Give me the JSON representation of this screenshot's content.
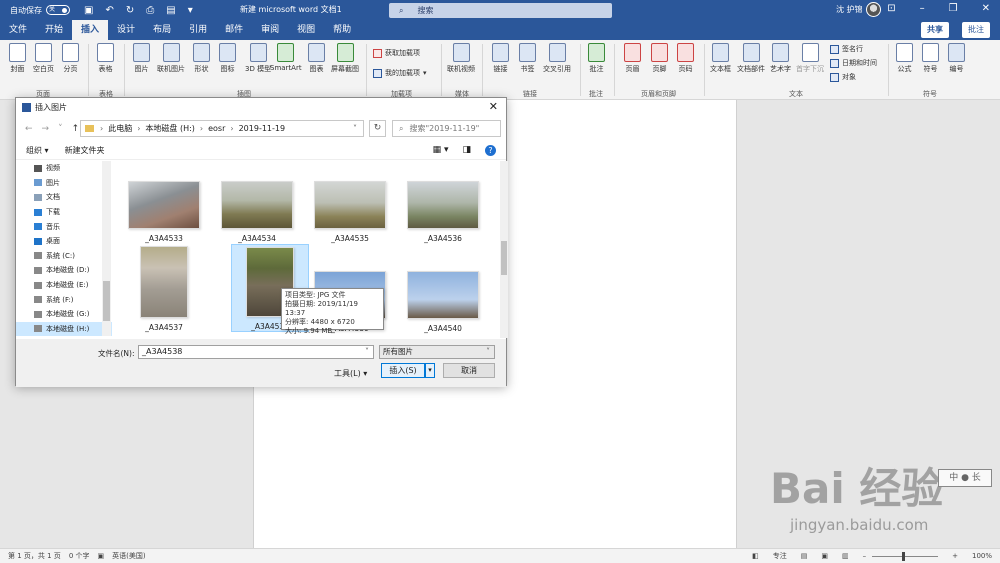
{
  "titlebar": {
    "autosave_label": "自动保存",
    "autosave_state": "关",
    "doc_title": "新建 microsoft word 文档1",
    "search_placeholder": "搜索",
    "user_name": "沈 护锦"
  },
  "tabs": [
    "文件",
    "开始",
    "插入",
    "设计",
    "布局",
    "引用",
    "邮件",
    "审阅",
    "视图",
    "帮助"
  ],
  "active_tab": "插入",
  "share_label": "共享",
  "comment_label": "批注",
  "ribbon": {
    "pages": [
      "封面",
      "空白页",
      "分页"
    ],
    "table": "表格",
    "illustrations": [
      "图片",
      "联机图片",
      "形状",
      "图标",
      "3D 模型",
      "SmartArt",
      "图表",
      "屏幕截图"
    ],
    "addins": [
      "获取加载项",
      "我的加载项"
    ],
    "media": "联机视频",
    "links": [
      "链接",
      "书签",
      "交叉引用"
    ],
    "comment": "批注",
    "header_footer": [
      "页眉",
      "页脚",
      "页码"
    ],
    "text": [
      "文本框",
      "文档部件",
      "艺术字",
      "首字下沉"
    ],
    "text_small": [
      "签名行",
      "日期和时间",
      "对象"
    ],
    "symbols": [
      "公式",
      "符号",
      "编号"
    ],
    "groups": [
      "页面",
      "表格",
      "插图",
      "加载项",
      "媒体",
      "链接",
      "批注",
      "页眉和页脚",
      "文本",
      "符号"
    ]
  },
  "dialog": {
    "title": "插入图片",
    "path": [
      "此电脑",
      "本地磁盘 (H:)",
      "eosr",
      "2019-11-19"
    ],
    "search_placeholder": "搜索\"2019-11-19\"",
    "organize": "组织 ▾",
    "new_folder": "新建文件夹",
    "nav_items": [
      "视频",
      "图片",
      "文档",
      "下载",
      "音乐",
      "桌面",
      "系统 (C:)",
      "本地磁盘 (D:)",
      "本地磁盘 (E:)",
      "系统 (F:)",
      "本地磁盘 (G:)",
      "本地磁盘 (H:)"
    ],
    "files": [
      "_A3A4533",
      "_A3A4534",
      "_A3A4535",
      "_A3A4536",
      "_A3A4537",
      "_A3A4538",
      "_A3A4539",
      "_A3A4540"
    ],
    "selected_file": "_A3A4538",
    "tooltip": {
      "type": "项目类型: JPG 文件",
      "date": "拍摄日期: 2019/11/19 13:37",
      "resolution": "分辨率: 4480 x 6720",
      "size": "大小: 9.94 MB"
    },
    "filename_label": "文件名(N):",
    "filename_value": "_A3A4538",
    "filetype": "所有图片",
    "tools": "工具(L)",
    "insert": "插入(S)",
    "cancel": "取消"
  },
  "statusbar": {
    "page": "第 1 页，共 1 页",
    "words": "0 个字",
    "language": "英语(美国)",
    "focus": "专注",
    "zoom": "100%"
  },
  "watermark": {
    "brand": "Bai 经验",
    "url": "jingyan.baidu.com",
    "stamp": "中 ● 长"
  },
  "colors": {
    "brand_blue": "#2b579a",
    "selection": "#cce8ff"
  }
}
